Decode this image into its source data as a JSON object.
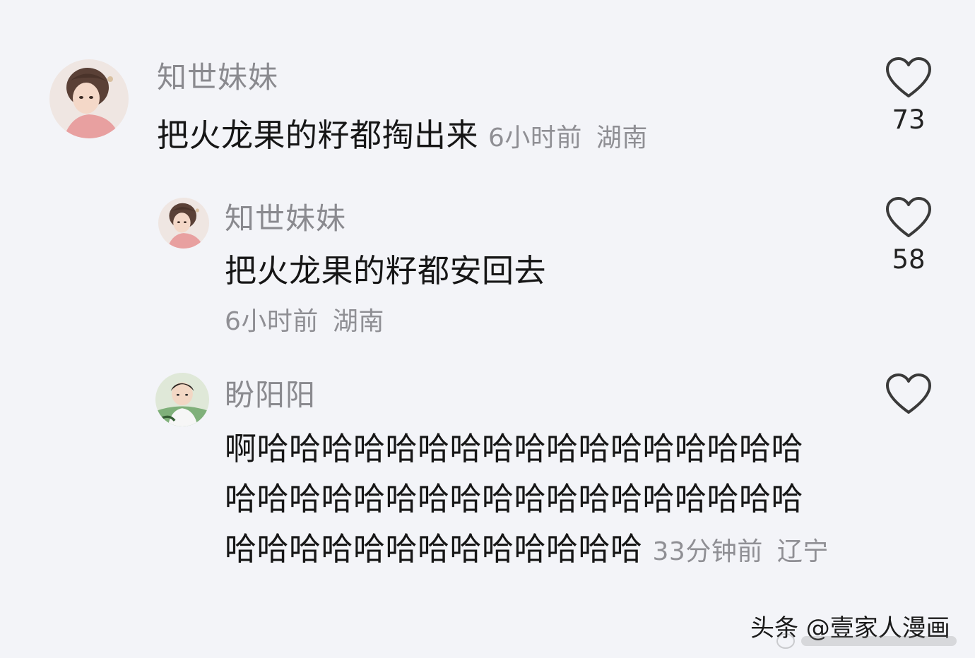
{
  "comments": [
    {
      "username": "知世妹妹",
      "text": "把火龙果的籽都掏出来",
      "time": "6小时前",
      "location": "湖南",
      "likes": "73"
    },
    {
      "username": "知世妹妹",
      "text": "把火龙果的籽都安回去",
      "time": "6小时前",
      "location": "湖南",
      "likes": "58"
    },
    {
      "username": "盼阳阳",
      "text": "啊哈哈哈哈哈哈哈哈哈哈哈哈哈哈哈哈哈哈哈哈哈哈哈哈哈哈哈哈哈哈哈哈哈哈哈哈哈哈哈哈哈哈哈哈哈哈哈哈",
      "time": "33分钟前",
      "location": "辽宁",
      "likes": ""
    }
  ],
  "watermark": {
    "text": "头条 @壹家人漫画"
  },
  "icons": {
    "like": "heart-outline-icon"
  },
  "colors": {
    "background": "#f3f4f8",
    "username": "#8a8a8f",
    "meta": "#8f8f94",
    "text": "#161616"
  }
}
